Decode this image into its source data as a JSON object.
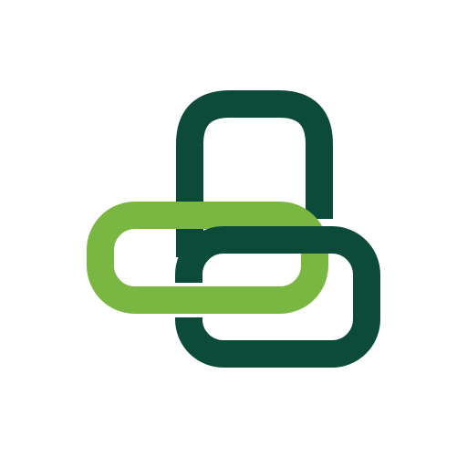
{
  "logo": {
    "icon": "interlocking-links-icon",
    "colors": {
      "dark_green": "#0c4a3a",
      "light_green": "#7ab642",
      "background": "#ffffff"
    }
  }
}
